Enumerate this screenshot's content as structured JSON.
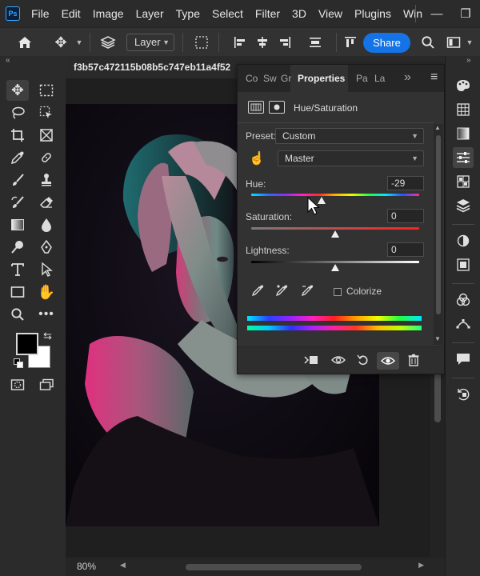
{
  "app": {
    "logo_text": "Ps"
  },
  "menu": {
    "items": [
      "File",
      "Edit",
      "Image",
      "Layer",
      "Type",
      "Select",
      "Filter",
      "3D",
      "View",
      "Plugins",
      "Win"
    ]
  },
  "window_controls": {
    "minimize": "—",
    "restore": "❐"
  },
  "options_bar": {
    "auto_select_target": "Layer",
    "share_label": "Share"
  },
  "document": {
    "tab_title": "f3b57c472115b08b5c747eb11a4f52",
    "zoom": "80%"
  },
  "properties_panel": {
    "tabs": [
      "Co",
      "Sw",
      "Gr",
      "Properties",
      "Pa",
      "La"
    ],
    "active_tab": "Properties",
    "overflow_glyph": "»",
    "menu_glyph": "≡",
    "adjustment_title": "Hue/Saturation",
    "preset_label": "Preset:",
    "preset_value": "Custom",
    "channel_value": "Master",
    "hue_label": "Hue:",
    "hue_value": "-29",
    "hue_position": 0.42,
    "saturation_label": "Saturation:",
    "saturation_value": "0",
    "saturation_position": 0.5,
    "lightness_label": "Lightness:",
    "lightness_value": "0",
    "lightness_position": 0.5,
    "colorize_label": "Colorize",
    "colorize_checked": false
  },
  "colors": {
    "accent": "#1473e6",
    "panel_bg": "#323232",
    "foreground_swatch": "#000000",
    "background_swatch": "#ffffff"
  }
}
